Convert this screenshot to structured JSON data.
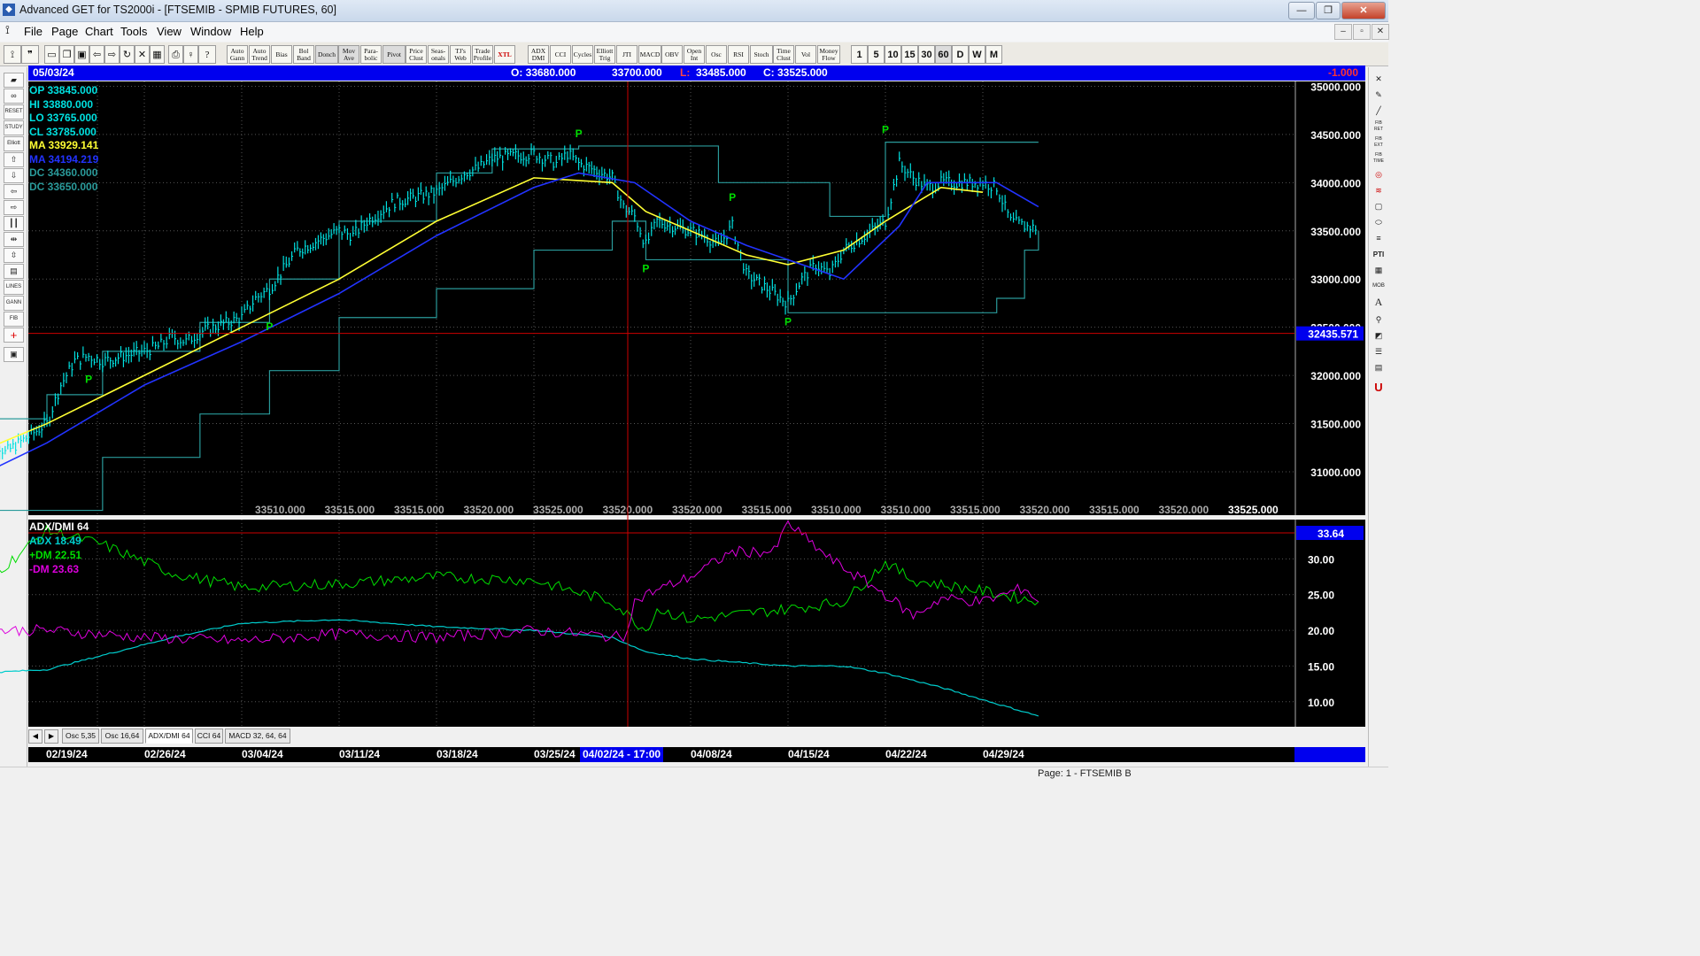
{
  "window": {
    "title": "Advanced GET for TS2000i - [FTSEMIB - SPMIB FUTURES, 60]",
    "controls": [
      "—",
      "❐",
      "✕"
    ]
  },
  "menu": {
    "items": [
      "File",
      "Page",
      "Chart",
      "Tools",
      "View",
      "Window",
      "Help"
    ],
    "mdi_controls": [
      "–",
      "▫",
      "✕"
    ]
  },
  "toolbar": {
    "study_buttons": [
      "Auto Gann",
      "Auto Trend",
      "Bias",
      "Bol Band",
      "Donch",
      "Mov Ave",
      "Para-bolic",
      "Pivot",
      "Price Clust",
      "Seas-onals",
      "TJ's Web",
      "Trade Profile",
      "XTL",
      "ADX DMI",
      "CCI",
      "Cycles",
      "Elliott Trig",
      "JTI",
      "MACD",
      "OBV",
      "Open Int",
      "Osc",
      "RSI",
      "Stoch",
      "Time Clust",
      "Vol",
      "Money Flow"
    ],
    "interval_buttons": [
      "1",
      "5",
      "10",
      "15",
      "30",
      "60",
      "D",
      "W",
      "M"
    ],
    "selected_interval": "60"
  },
  "left_tools": [
    "RESET",
    "STUDY",
    "Elliott",
    "LINES",
    "GANN",
    "FIB"
  ],
  "right_tools": [
    "FIB RET",
    "FIB EXT",
    "FIB TIME",
    "PTI",
    "MOB",
    "A",
    "U"
  ],
  "info_bar": {
    "date": "05/03/24",
    "open": "O: 33680.000",
    "high": "33700.000",
    "low_label": "L:",
    "low": "33485.000",
    "close": "C: 33525.000",
    "change": "-1.000"
  },
  "price_legend": [
    {
      "label": "OP",
      "value": "33845.000",
      "color": "#00e0e0"
    },
    {
      "label": "HI",
      "value": "33880.000",
      "color": "#00e0e0"
    },
    {
      "label": "LO",
      "value": "33765.000",
      "color": "#00e0e0"
    },
    {
      "label": "CL",
      "value": "33785.000",
      "color": "#00e0e0"
    },
    {
      "label": "MA",
      "value": "33929.141",
      "color": "#ffff33"
    },
    {
      "label": "MA",
      "value": "34194.219",
      "color": "#2233ff"
    },
    {
      "label": "DC",
      "value": "34360.000",
      "color": "#2a9a9a"
    },
    {
      "label": "DC",
      "value": "33650.000",
      "color": "#2a9a9a"
    }
  ],
  "chart_data": [
    {
      "type": "bar",
      "title": "FTSEMIB - SPMIB FUTURES, 60",
      "series": [
        {
          "name": "Price",
          "color": "#00e0e0"
        },
        {
          "name": "MA",
          "color": "#ffff33"
        },
        {
          "name": "MA",
          "color": "#2233ff"
        },
        {
          "name": "DC",
          "color": "#2a9a9a"
        }
      ],
      "y_ticks": [
        35000,
        34500,
        34000,
        33500,
        33000,
        32500,
        32000,
        31500,
        31000
      ],
      "y_tick_labels": [
        "35000.000",
        "34500.000",
        "34000.000",
        "33500.000",
        "33000.000",
        "32500.000",
        "32000.000",
        "31500.000",
        "31000.000"
      ],
      "ylim": [
        30550,
        35050
      ],
      "cursor_price": "32435.571",
      "cursor_price_value": 32435.571,
      "date_labels": [
        "02/19/24",
        "02/26/24",
        "03/04/24",
        "03/11/24",
        "03/18/24",
        "03/25/24",
        "04/08/24",
        "04/15/24",
        "04/22/24",
        "04/29/24"
      ],
      "cursor_date": "04/02/24 - 17:00",
      "bottom_values": [
        "33510.000",
        "33515.000",
        "33515.000",
        "33520.000",
        "33525.000",
        "33520.000",
        "33520.000",
        "33515.000",
        "33510.000",
        "33510.000",
        "33515.000",
        "33520.000",
        "33515.000",
        "33520.000",
        "33525.000"
      ],
      "pivot_marker": "P",
      "pivots": [
        {
          "date": "02/22/24",
          "price": 32050,
          "position": "low"
        },
        {
          "date": "03/06/24",
          "price": 32600,
          "position": "low"
        },
        {
          "date": "03/29/24",
          "price": 34380,
          "position": "high"
        },
        {
          "date": "04/04/24",
          "price": 33200,
          "position": "low"
        },
        {
          "date": "04/11/24",
          "price": 33720,
          "position": "high"
        },
        {
          "date": "04/15/24",
          "price": 32650,
          "position": "low"
        },
        {
          "date": "04/22/24",
          "price": 34420,
          "position": "high"
        }
      ],
      "price_path": [
        [
          "02/14/24",
          31450
        ],
        [
          "02/15/24",
          31350
        ],
        [
          "02/16/24",
          31200
        ],
        [
          "02/19/24",
          31500
        ],
        [
          "02/20/24",
          31900
        ],
        [
          "02/21/24",
          32150
        ],
        [
          "02/22/24",
          32200
        ],
        [
          "02/23/24",
          32150
        ],
        [
          "02/26/24",
          32250
        ],
        [
          "02/27/24",
          32300
        ],
        [
          "02/28/24",
          32400
        ],
        [
          "02/29/24",
          32350
        ],
        [
          "03/01/24",
          32450
        ],
        [
          "03/04/24",
          32600
        ],
        [
          "03/05/24",
          32800
        ],
        [
          "03/06/24",
          32900
        ],
        [
          "03/07/24",
          33100
        ],
        [
          "03/08/24",
          33300
        ],
        [
          "03/11/24",
          33500
        ],
        [
          "03/12/24",
          33450
        ],
        [
          "03/13/24",
          33600
        ],
        [
          "03/14/24",
          33700
        ],
        [
          "03/15/24",
          33800
        ],
        [
          "03/18/24",
          33900
        ],
        [
          "03/19/24",
          34000
        ],
        [
          "03/20/24",
          34100
        ],
        [
          "03/21/24",
          34150
        ],
        [
          "03/22/24",
          34250
        ],
        [
          "03/25/24",
          34300
        ],
        [
          "03/26/24",
          34250
        ],
        [
          "03/27/24",
          34200
        ],
        [
          "03/28/24",
          34300
        ],
        [
          "03/29/24",
          34200
        ],
        [
          "04/01/24",
          34050
        ],
        [
          "04/02/24",
          33750
        ],
        [
          "04/03/24",
          33650
        ],
        [
          "04/04/24",
          33350
        ],
        [
          "04/05/24",
          33600
        ],
        [
          "04/08/24",
          33500
        ],
        [
          "04/09/24",
          33450
        ],
        [
          "04/10/24",
          33350
        ],
        [
          "04/11/24",
          33550
        ],
        [
          "04/12/24",
          33050
        ],
        [
          "04/15/24",
          32750
        ],
        [
          "04/16/24",
          33000
        ],
        [
          "04/17/24",
          33150
        ],
        [
          "04/18/24",
          33050
        ],
        [
          "04/19/24",
          33300
        ],
        [
          "04/22/24",
          33600
        ],
        [
          "04/23/24",
          34200
        ],
        [
          "04/24/24",
          34050
        ],
        [
          "04/25/24",
          33950
        ],
        [
          "04/26/24",
          34000
        ],
        [
          "04/29/24",
          34000
        ],
        [
          "04/30/24",
          33950
        ],
        [
          "05/01/24",
          33600
        ],
        [
          "05/02/24",
          33550
        ],
        [
          "05/03/24",
          33525
        ]
      ],
      "ma_yellow": [
        [
          "02/14/24",
          31200
        ],
        [
          "02/19/24",
          31500
        ],
        [
          "02/26/24",
          32000
        ],
        [
          "03/04/24",
          32500
        ],
        [
          "03/11/24",
          33000
        ],
        [
          "03/18/24",
          33600
        ],
        [
          "03/25/24",
          34050
        ],
        [
          "04/01/24",
          34000
        ],
        [
          "04/04/24",
          33700
        ],
        [
          "04/08/24",
          33500
        ],
        [
          "04/12/24",
          33250
        ],
        [
          "04/15/24",
          33150
        ],
        [
          "04/19/24",
          33300
        ],
        [
          "04/22/24",
          33600
        ],
        [
          "04/26/24",
          33950
        ],
        [
          "04/29/24",
          33900
        ]
      ],
      "ma_blue": [
        [
          "02/14/24",
          30950
        ],
        [
          "02/19/24",
          31300
        ],
        [
          "02/26/24",
          31900
        ],
        [
          "03/04/24",
          32350
        ],
        [
          "03/11/24",
          32850
        ],
        [
          "03/18/24",
          33450
        ],
        [
          "03/25/24",
          33950
        ],
        [
          "03/29/24",
          34100
        ],
        [
          "04/03/24",
          34000
        ],
        [
          "04/08/24",
          33600
        ],
        [
          "04/12/24",
          33350
        ],
        [
          "04/16/24",
          33150
        ],
        [
          "04/19/24",
          33000
        ],
        [
          "04/23/24",
          33550
        ],
        [
          "04/25/24",
          34000
        ],
        [
          "04/30/24",
          34000
        ],
        [
          "05/03/24",
          33750
        ]
      ],
      "dc_upper": [
        [
          "02/14/24",
          31550
        ],
        [
          "02/19/24",
          31800
        ],
        [
          "02/23/24",
          32250
        ],
        [
          "03/01/24",
          32550
        ],
        [
          "03/06/24",
          33000
        ],
        [
          "03/11/24",
          33600
        ],
        [
          "03/18/24",
          34100
        ],
        [
          "03/22/24",
          34350
        ],
        [
          "03/29/24",
          34380
        ],
        [
          "04/09/24",
          34380
        ],
        [
          "04/10/24",
          34000
        ],
        [
          "04/17/24",
          34000
        ],
        [
          "04/18/24",
          33650
        ],
        [
          "04/22/24",
          34420
        ],
        [
          "05/03/24",
          34420
        ]
      ],
      "dc_lower": [
        [
          "02/14/24",
          30600
        ],
        [
          "02/23/24",
          31150
        ],
        [
          "03/01/24",
          31600
        ],
        [
          "03/06/24",
          32050
        ],
        [
          "03/11/24",
          32600
        ],
        [
          "03/18/24",
          32900
        ],
        [
          "03/25/24",
          33300
        ],
        [
          "04/01/24",
          33600
        ],
        [
          "04/04/24",
          33200
        ],
        [
          "04/15/24",
          32650
        ],
        [
          "04/30/24",
          32800
        ],
        [
          "05/02/24",
          33300
        ],
        [
          "05/03/24",
          33500
        ]
      ]
    },
    {
      "type": "line",
      "title": "ADX/DMI 64",
      "series": [
        {
          "name": "ADX",
          "value": "18.49",
          "color": "#00cccc"
        },
        {
          "name": "+DM",
          "value": "22.51",
          "color": "#00dd00"
        },
        {
          "name": "-DM",
          "value": "23.63",
          "color": "#dd00dd"
        }
      ],
      "y_ticks": [
        30,
        25,
        20,
        15,
        10
      ],
      "y_tick_labels": [
        "30.00",
        "25.00",
        "20.00",
        "15.00",
        "10.00"
      ],
      "ylim": [
        6.5,
        35.5
      ],
      "cursor_value": "33.64",
      "cursor_value_num": 33.64,
      "adx": [
        [
          "02/14/24",
          14.0
        ],
        [
          "02/19/24",
          14.5
        ],
        [
          "02/23/24",
          16.5
        ],
        [
          "02/28/24",
          19.0
        ],
        [
          "03/04/24",
          21.0
        ],
        [
          "03/11/24",
          21.5
        ],
        [
          "03/18/24",
          20.5
        ],
        [
          "03/25/24",
          20.0
        ],
        [
          "04/01/24",
          19.0
        ],
        [
          "04/04/24",
          17.0
        ],
        [
          "04/08/24",
          16.0
        ],
        [
          "04/15/24",
          15.0
        ],
        [
          "04/19/24",
          15.0
        ],
        [
          "04/22/24",
          14.0
        ],
        [
          "04/26/24",
          12.0
        ],
        [
          "05/03/24",
          8.0
        ]
      ],
      "plus_dm": [
        [
          "02/14/24",
          27.0
        ],
        [
          "02/16/24",
          29.0
        ],
        [
          "02/19/24",
          34.0
        ],
        [
          "02/23/24",
          32.0
        ],
        [
          "02/28/24",
          28.0
        ],
        [
          "03/04/24",
          26.0
        ],
        [
          "03/11/24",
          26.5
        ],
        [
          "03/18/24",
          27.5
        ],
        [
          "03/25/24",
          27.0
        ],
        [
          "04/01/24",
          24.0
        ],
        [
          "04/04/24",
          20.0
        ],
        [
          "04/05/24",
          23.0
        ],
        [
          "04/08/24",
          21.5
        ],
        [
          "04/15/24",
          23.0
        ],
        [
          "04/19/24",
          24.0
        ],
        [
          "04/22/24",
          29.5
        ],
        [
          "04/24/24",
          27.0
        ],
        [
          "04/29/24",
          25.5
        ],
        [
          "05/03/24",
          24.0
        ]
      ],
      "minus_dm": [
        [
          "02/14/24",
          20.0
        ],
        [
          "02/19/24",
          20.0
        ],
        [
          "02/26/24",
          19.0
        ],
        [
          "03/04/24",
          18.5
        ],
        [
          "03/11/24",
          19.5
        ],
        [
          "03/18/24",
          19.0
        ],
        [
          "03/25/24",
          20.0
        ],
        [
          "04/02/24",
          19.0
        ],
        [
          "04/03/24",
          24.0
        ],
        [
          "04/04/24",
          25.0
        ],
        [
          "04/08/24",
          27.5
        ],
        [
          "04/11/24",
          31.0
        ],
        [
          "04/14/24",
          31.0
        ],
        [
          "04/15/24",
          35.0
        ],
        [
          "04/18/24",
          30.0
        ],
        [
          "04/22/24",
          25.0
        ],
        [
          "04/24/24",
          22.0
        ],
        [
          "04/26/24",
          24.5
        ],
        [
          "04/29/24",
          24.0
        ],
        [
          "05/02/24",
          26.0
        ],
        [
          "05/03/24",
          24.0
        ]
      ]
    }
  ],
  "osc_tabs": [
    "Osc 5,35",
    "Osc 16,64",
    "ADX/DMI 64",
    "CCI 64",
    "MACD 32, 64, 64"
  ],
  "active_osc_tab": "ADX/DMI 64",
  "status": {
    "page": "Page: 1 - FTSEMIB B"
  }
}
